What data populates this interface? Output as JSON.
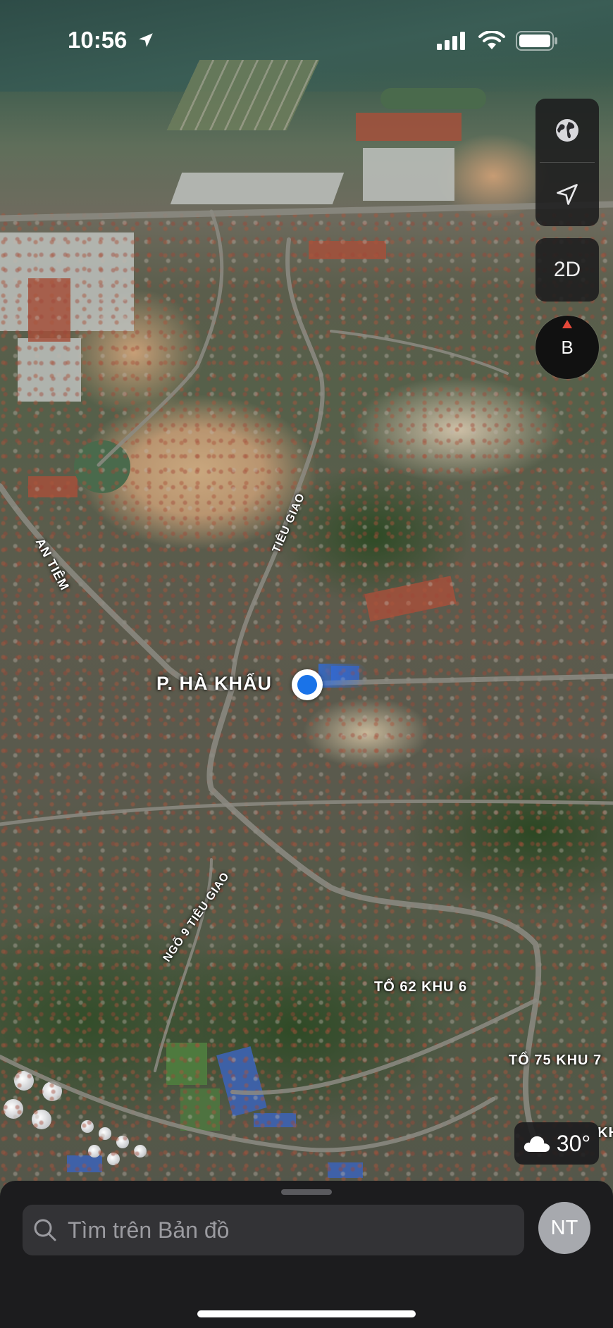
{
  "status_bar": {
    "time": "10:56"
  },
  "map": {
    "labels": {
      "district": "P. HÀ KHẨU",
      "road_an_tiem": "AN TIÊM",
      "road_tieu_giao": "TIÊU GIAO",
      "road_ngo9": "NGÕ 9 TIÊU GIAO",
      "area_to62": "TỔ 62 KHU 6",
      "area_to75": "TỔ 75 KHU 7",
      "area_kh_partial": "KH"
    }
  },
  "controls": {
    "globe_icon": "globe-icon",
    "location_icon": "location-arrow-icon",
    "view_mode": "2D",
    "compass_letter": "B"
  },
  "weather": {
    "temperature": "30°",
    "icon": "cloud-icon"
  },
  "sheet": {
    "search_placeholder": "Tìm trên Bản đồ",
    "avatar_initials": "NT"
  }
}
